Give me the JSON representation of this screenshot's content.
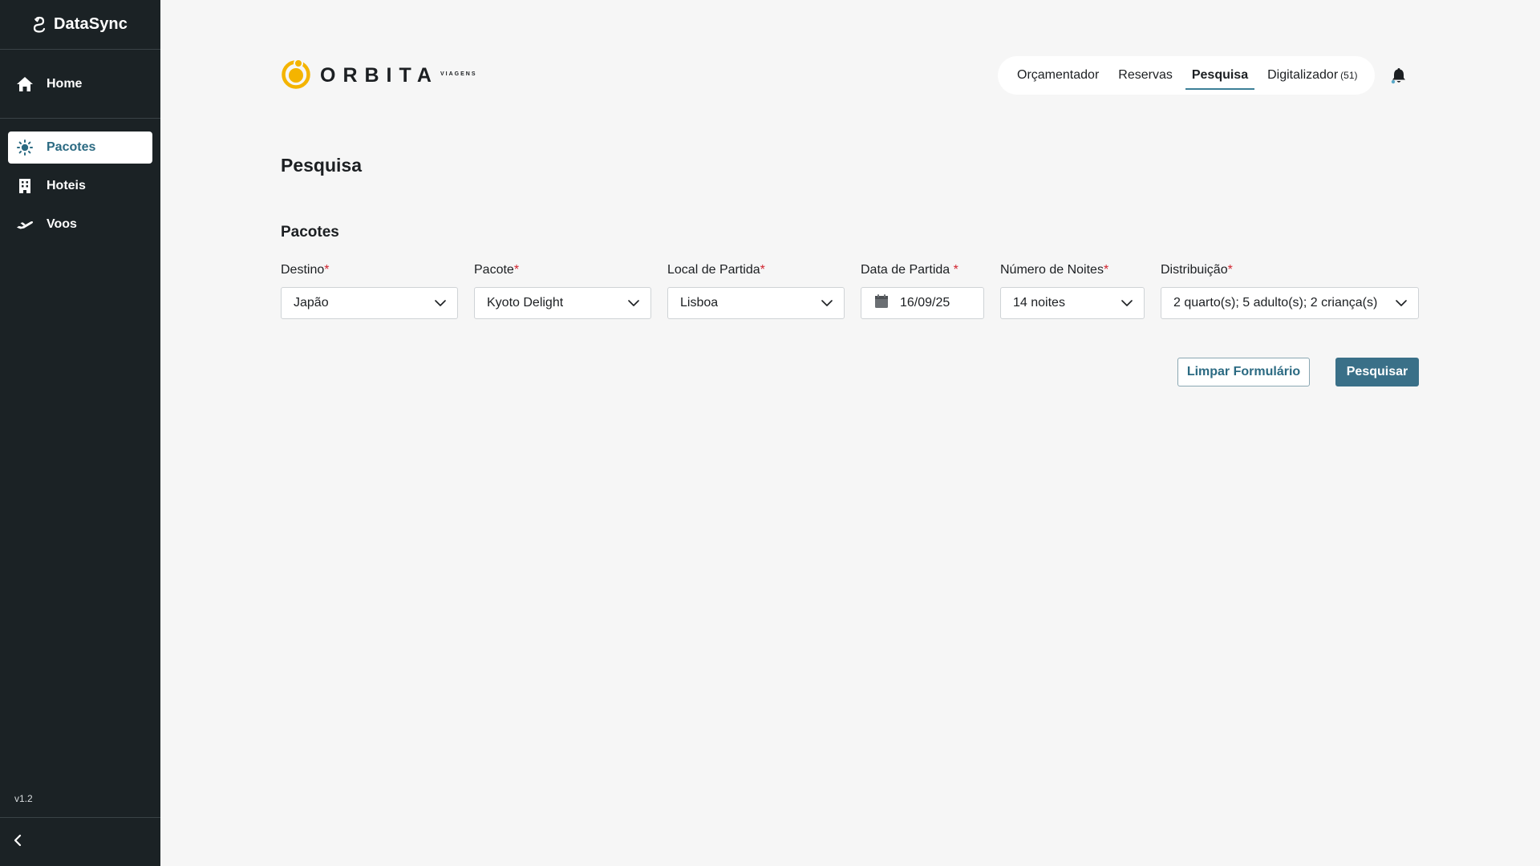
{
  "app": {
    "name": "DataSync",
    "version": "v1.2"
  },
  "sidebar": {
    "home": {
      "label": "Home",
      "icon": "home-icon"
    },
    "items": [
      {
        "label": "Pacotes",
        "icon": "sun-icon",
        "active": true
      },
      {
        "label": "Hoteis",
        "icon": "building-icon",
        "active": false
      },
      {
        "label": "Voos",
        "icon": "plane-icon",
        "active": false
      }
    ],
    "collapse_icon": "chevron-left-icon"
  },
  "header": {
    "logo": {
      "word": "ORBITA",
      "sub": "VIAGENS"
    },
    "nav": [
      {
        "label": "Orçamentador",
        "active": false
      },
      {
        "label": "Reservas",
        "active": false
      },
      {
        "label": "Pesquisa",
        "active": true
      },
      {
        "label": "Digitalizador",
        "count": "(51)",
        "active": false
      }
    ],
    "notification_icon": "bell-icon"
  },
  "main": {
    "title": "Pesquisa",
    "section": "Pacotes",
    "fields": {
      "destino": {
        "label": "Destino",
        "value": "Japão",
        "required": "*"
      },
      "pacote": {
        "label": "Pacote",
        "value": "Kyoto Delight",
        "required": "*"
      },
      "local_partida": {
        "label": "Local de Partida",
        "value": "Lisboa",
        "required": "*"
      },
      "data_partida": {
        "label": "Data de Partida ",
        "value": "16/09/25",
        "required": "*"
      },
      "noites": {
        "label": "Número de Noites",
        "value": "14 noites",
        "required": "*"
      },
      "distribuicao": {
        "label": "Distribuição",
        "value": "2 quarto(s); 5 adulto(s); 2 criança(s)",
        "required": "*"
      }
    },
    "buttons": {
      "clear": "Limpar Formulário",
      "search": "Pesquisar"
    }
  },
  "colors": {
    "sidebar_bg": "#1b2225",
    "accent": "#3a7088",
    "active_text": "#2b6a82",
    "logo_yellow": "#f4b400",
    "required": "#d1242f",
    "page_bg": "#f6f6f6"
  }
}
